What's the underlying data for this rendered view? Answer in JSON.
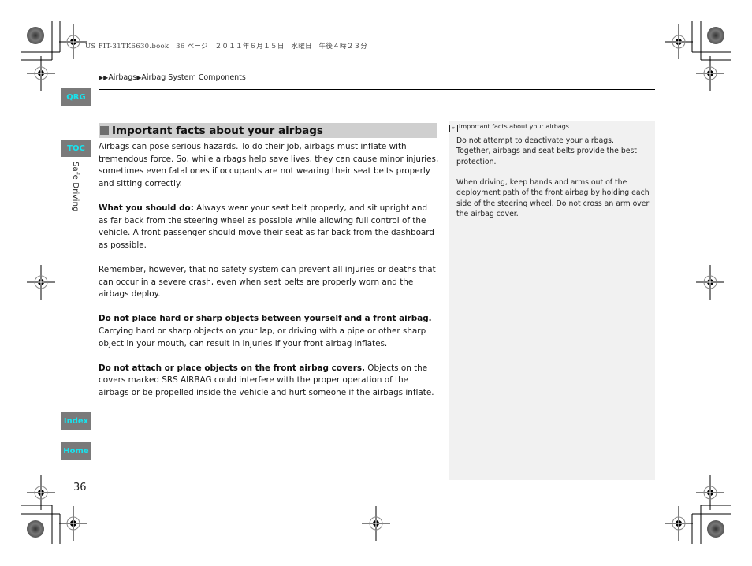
{
  "print_header": "US FIT-31TK6630.book　36 ページ　２０１１年６月１５日　水曜日　午後４時２３分",
  "breadcrumb": {
    "items": [
      "Airbags",
      "Airbag System Components"
    ]
  },
  "nav": {
    "qrg": "QRG",
    "toc": "TOC",
    "index": "Index",
    "home": "Home",
    "accent_color": "#18e3ee",
    "button_color": "#7a7a7a"
  },
  "chapter_label": "Safe Driving",
  "section": {
    "title": "Important facts about your airbags",
    "paragraphs": [
      {
        "bold": "",
        "text": "Airbags can pose serious hazards. To do their job, airbags must inflate with tremendous force. So, while airbags help save lives, they can cause minor injuries, sometimes even fatal ones if occupants are not wearing their seat belts properly and sitting correctly."
      },
      {
        "bold": "What you should do:",
        "text": " Always wear your seat belt properly, and sit upright and as far back from the steering wheel as possible while allowing full control of the vehicle. A front passenger should move their seat as far back from the dashboard as possible."
      },
      {
        "bold": "",
        "text": "Remember, however, that no safety system can prevent all injuries or deaths that can occur in a severe crash, even when seat belts are properly worn and the airbags deploy."
      },
      {
        "bold": "Do not place hard or sharp objects between yourself and a front airbag.",
        "text": " Carrying hard or sharp objects on your lap, or driving with a pipe or other sharp object in your mouth, can result in injuries if your front airbag inflates."
      },
      {
        "bold": "Do not attach or place objects on the front airbag covers.",
        "text": " Objects on the covers marked SRS AIRBAG could interfere with the proper operation of the airbags or be propelled inside the vehicle and hurt someone if the airbags inflate."
      }
    ]
  },
  "sidebar": {
    "title": "Important facts about your airbags",
    "paragraphs": [
      "Do not attempt to deactivate your airbags. Together, airbags and seat belts provide the best protection.",
      "When driving, keep hands and arms out of the deployment path of the front airbag by holding each side of the steering wheel. Do not cross an arm over the airbag cover."
    ]
  },
  "page_number": "36"
}
